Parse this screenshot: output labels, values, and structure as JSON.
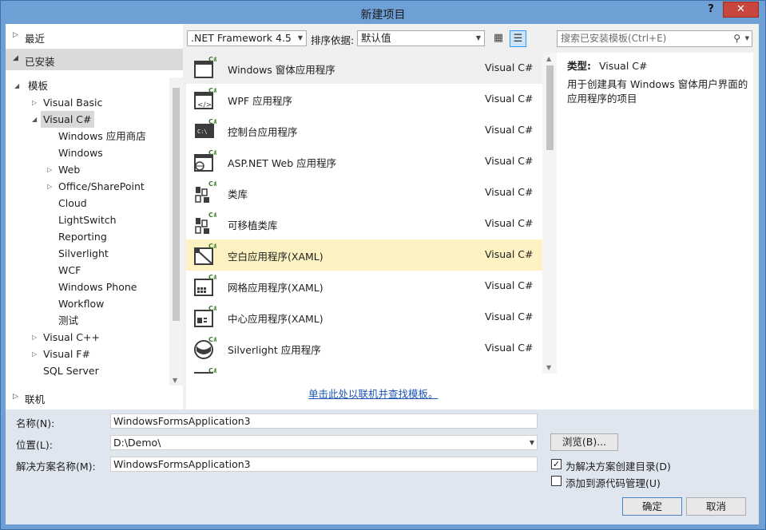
{
  "window": {
    "title": "新建项目",
    "help_label": "?",
    "close_label": "✕"
  },
  "left_panel": {
    "recent_label": "最近",
    "installed_label": "已安装",
    "online_label": "联机",
    "tree": [
      {
        "label": "模板",
        "level": 0,
        "arrow": "◢"
      },
      {
        "label": "Visual Basic",
        "level": 1,
        "arrow": "▷"
      },
      {
        "label": "Visual C#",
        "level": 1,
        "arrow": "◢"
      },
      {
        "label": "Windows 应用商店",
        "level": 2,
        "arrow": ""
      },
      {
        "label": "Windows",
        "level": 2,
        "arrow": ""
      },
      {
        "label": "Web",
        "level": 2,
        "arrow": "▷"
      },
      {
        "label": "Office/SharePoint",
        "level": 2,
        "arrow": "▷"
      },
      {
        "label": "Cloud",
        "level": 2,
        "arrow": ""
      },
      {
        "label": "LightSwitch",
        "level": 2,
        "arrow": ""
      },
      {
        "label": "Reporting",
        "level": 2,
        "arrow": ""
      },
      {
        "label": "Silverlight",
        "level": 2,
        "arrow": ""
      },
      {
        "label": "WCF",
        "level": 2,
        "arrow": ""
      },
      {
        "label": "Windows Phone",
        "level": 2,
        "arrow": ""
      },
      {
        "label": "Workflow",
        "level": 2,
        "arrow": ""
      },
      {
        "label": "测试",
        "level": 2,
        "arrow": ""
      },
      {
        "label": "Visual C++",
        "level": 1,
        "arrow": "▷"
      },
      {
        "label": "Visual F#",
        "level": 1,
        "arrow": "▷"
      },
      {
        "label": "SQL Server",
        "level": 1,
        "arrow": ""
      }
    ]
  },
  "toolbar": {
    "framework": ".NET Framework 4.5",
    "sort_label": "排序依据:",
    "sort_value": "默认值",
    "search_placeholder": "搜索已安装模板(Ctrl+E)"
  },
  "templates": [
    {
      "name": "Windows 窗体应用程序",
      "lang": "Visual C#",
      "icon": "winforms-icon"
    },
    {
      "name": "WPF 应用程序",
      "lang": "Visual C#",
      "icon": "wpf-icon"
    },
    {
      "name": "控制台应用程序",
      "lang": "Visual C#",
      "icon": "console-icon"
    },
    {
      "name": "ASP.NET Web 应用程序",
      "lang": "Visual C#",
      "icon": "aspnet-icon"
    },
    {
      "name": "类库",
      "lang": "Visual C#",
      "icon": "class-library-icon"
    },
    {
      "name": "可移植类库",
      "lang": "Visual C#",
      "icon": "portable-library-icon"
    },
    {
      "name": "空白应用程序(XAML)",
      "lang": "Visual C#",
      "icon": "blank-app-icon"
    },
    {
      "name": "网格应用程序(XAML)",
      "lang": "Visual C#",
      "icon": "grid-app-icon"
    },
    {
      "name": "中心应用程序(XAML)",
      "lang": "Visual C#",
      "icon": "hub-app-icon"
    },
    {
      "name": "Silverlight 应用程序",
      "lang": "Visual C#",
      "icon": "silverlight-icon"
    }
  ],
  "online_link": "单击此处以联机并查找模板。",
  "details": {
    "type_label": "类型:",
    "type_value": "Visual C#",
    "description": "用于创建具有 Windows 窗体用户界面的应用程序的项目"
  },
  "form": {
    "name_label": "名称(N):",
    "name_value": "WindowsFormsApplication3",
    "location_label": "位置(L):",
    "location_value": "D:\\Demo\\",
    "solution_label": "解决方案名称(M):",
    "solution_value": "WindowsFormsApplication3",
    "browse_label": "浏览(B)...",
    "create_dir_label": "为解决方案创建目录(D)",
    "create_dir_checked": true,
    "source_control_label": "添加到源代码管理(U)",
    "source_control_checked": false,
    "ok_label": "确定",
    "cancel_label": "取消"
  }
}
